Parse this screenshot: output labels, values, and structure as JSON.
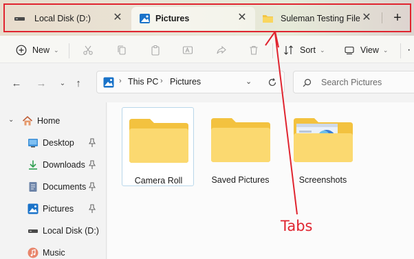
{
  "tabs": [
    {
      "label": "Local Disk (D:)",
      "icon": "drive-icon",
      "active": false
    },
    {
      "label": "Pictures",
      "icon": "pictures-icon",
      "active": true
    },
    {
      "label": "Suleman Testing File",
      "icon": "folder-icon",
      "active": false
    }
  ],
  "new_tab_symbol": "+",
  "tab_close_symbol": "✕",
  "toolbar": {
    "new_label": "New",
    "sort_label": "Sort",
    "view_label": "View",
    "more_symbol": "·"
  },
  "address": {
    "segments": [
      "This PC",
      "Pictures"
    ]
  },
  "search": {
    "placeholder": "Search Pictures"
  },
  "sidebar": {
    "items": [
      {
        "label": "Home",
        "icon": "home-icon"
      },
      {
        "label": "Desktop",
        "icon": "desktop-icon",
        "pinned": true
      },
      {
        "label": "Downloads",
        "icon": "downloads-icon",
        "pinned": true
      },
      {
        "label": "Documents",
        "icon": "documents-icon",
        "pinned": true
      },
      {
        "label": "Pictures",
        "icon": "pictures-icon",
        "pinned": true
      },
      {
        "label": "Local Disk (D:)",
        "icon": "drive-icon"
      },
      {
        "label": "Music",
        "icon": "music-icon"
      }
    ]
  },
  "folders": [
    {
      "name": "Camera Roll",
      "selected": true
    },
    {
      "name": "Saved Pictures",
      "selected": false
    },
    {
      "name": "Screenshots",
      "selected": false
    }
  ],
  "annotation": {
    "label": "Tabs",
    "color": "#e0242f"
  },
  "colors": {
    "folder": "#f9d05c",
    "accent": "#1a73c9"
  }
}
